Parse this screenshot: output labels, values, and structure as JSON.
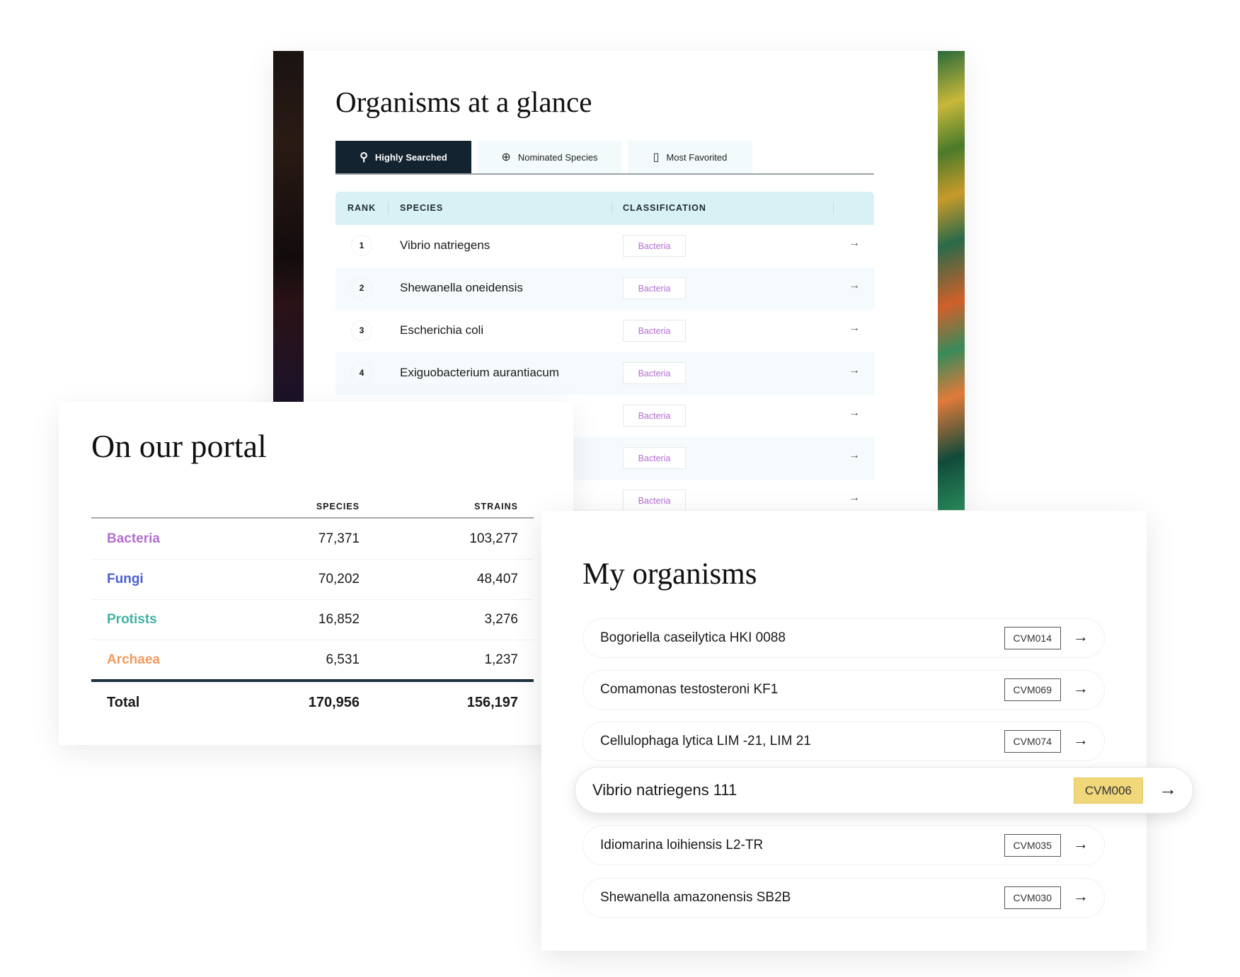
{
  "glance": {
    "title": "Organisms at a glance",
    "tabs": [
      {
        "label": "Highly Searched",
        "icon": "search-icon",
        "active": true
      },
      {
        "label": "Nominated Species",
        "icon": "plus-circle-icon",
        "active": false
      },
      {
        "label": "Most Favorited",
        "icon": "bookmark-icon",
        "active": false
      }
    ],
    "columns": {
      "rank": "RANK",
      "species": "SPECIES",
      "classification": "CLASSIFICATION"
    },
    "rows": [
      {
        "rank": "1",
        "species": "Vibrio natriegens",
        "classification": "Bacteria"
      },
      {
        "rank": "2",
        "species": "Shewanella oneidensis",
        "classification": "Bacteria"
      },
      {
        "rank": "3",
        "species": "Escherichia coli",
        "classification": "Bacteria"
      },
      {
        "rank": "4",
        "species": "Exiguobacterium aurantiacum",
        "classification": "Bacteria"
      },
      {
        "classification": "Bacteria"
      },
      {
        "classification": "Bacteria"
      },
      {
        "classification": "Bacteria"
      }
    ],
    "arrow": "→"
  },
  "portal": {
    "title": "On our portal",
    "columns": {
      "species": "SPECIES",
      "strains": "STRAINS"
    },
    "rows": [
      {
        "label": "Bacteria",
        "species": "77,371",
        "strains": "103,277",
        "color": "#b46fd1"
      },
      {
        "label": "Fungi",
        "species": "70,202",
        "strains": "48,407",
        "color": "#4c5fd0"
      },
      {
        "label": "Protists",
        "species": "16,852",
        "strains": "3,276",
        "color": "#3fb3a3"
      },
      {
        "label": "Archaea",
        "species": "6,531",
        "strains": "1,237",
        "color": "#f29a5e"
      }
    ],
    "total": {
      "label": "Total",
      "species": "170,956",
      "strains": "156,197"
    }
  },
  "my_organisms": {
    "title": "My organisms",
    "items": [
      {
        "name": "Bogoriella caseilytica HKI 0088",
        "code": "CVM014"
      },
      {
        "name": "Comamonas testosteroni KF1",
        "code": "CVM069"
      },
      {
        "name": "Cellulophaga lytica LIM -21, LIM 21",
        "code": "CVM074"
      },
      {
        "name": "Vibrio natriegens 111",
        "code": "CVM006",
        "highlighted": true
      },
      {
        "name": "Idiomarina loihiensis L2-TR",
        "code": "CVM035"
      },
      {
        "name": "Shewanella amazonensis SB2B",
        "code": "CVM030"
      }
    ],
    "highlight_color": "#f0d77a"
  }
}
